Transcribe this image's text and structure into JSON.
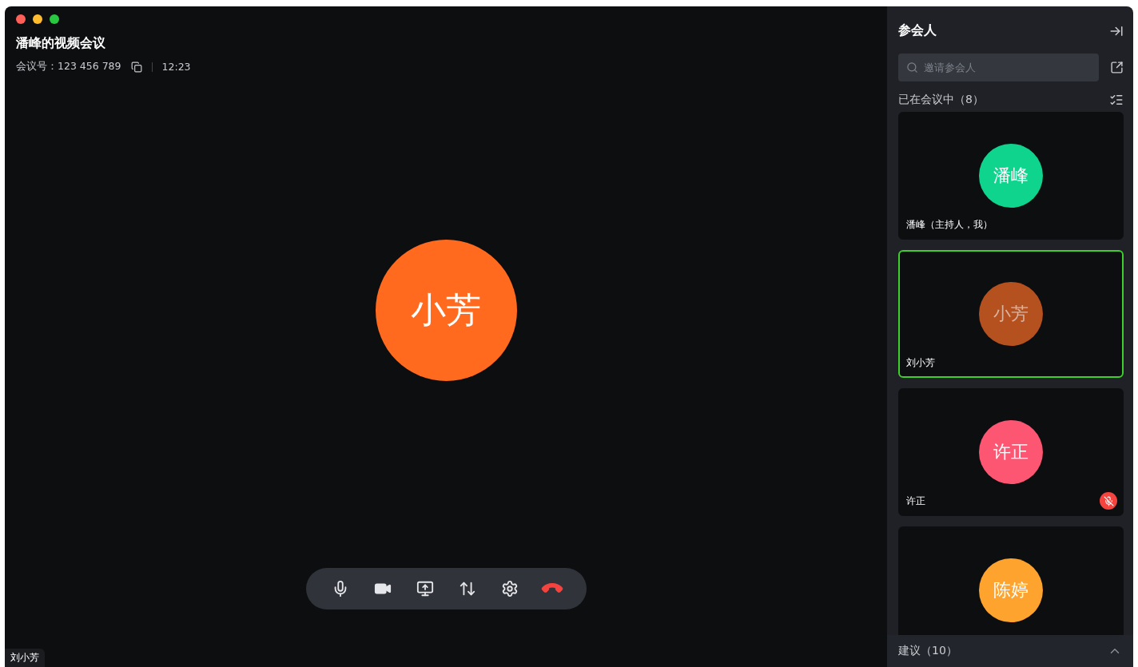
{
  "window": {
    "title": "潘峰的视频会议"
  },
  "meeting": {
    "id_label": "会议号：123 456 789",
    "time": "12:23"
  },
  "stage": {
    "avatar": "小芳",
    "color": "#ff6a1f",
    "name_tag": "刘小芳"
  },
  "toolbar": [
    {
      "kind": "mic"
    },
    {
      "kind": "camera"
    },
    {
      "kind": "share"
    },
    {
      "kind": "layout"
    },
    {
      "kind": "settings"
    },
    {
      "kind": "hangup"
    }
  ],
  "sidebar": {
    "title": "参会人",
    "search": {
      "placeholder": "邀请参会人"
    },
    "section": "已在会议中（8）",
    "participants": [
      {
        "avatar": "潘峰",
        "color": "#0fd48e",
        "name": "潘峰（主持人，我）",
        "selected": false,
        "muted": false
      },
      {
        "avatar": "小芳",
        "color": "#b5501f",
        "name": "刘小芳",
        "selected": true,
        "muted": false
      },
      {
        "avatar": "许正",
        "color": "#fd5673",
        "name": "许正",
        "selected": false,
        "muted": true
      },
      {
        "avatar": "陈婷",
        "color": "#fda32e",
        "selected": false,
        "muted": false
      }
    ],
    "footer": "建议（10）"
  }
}
